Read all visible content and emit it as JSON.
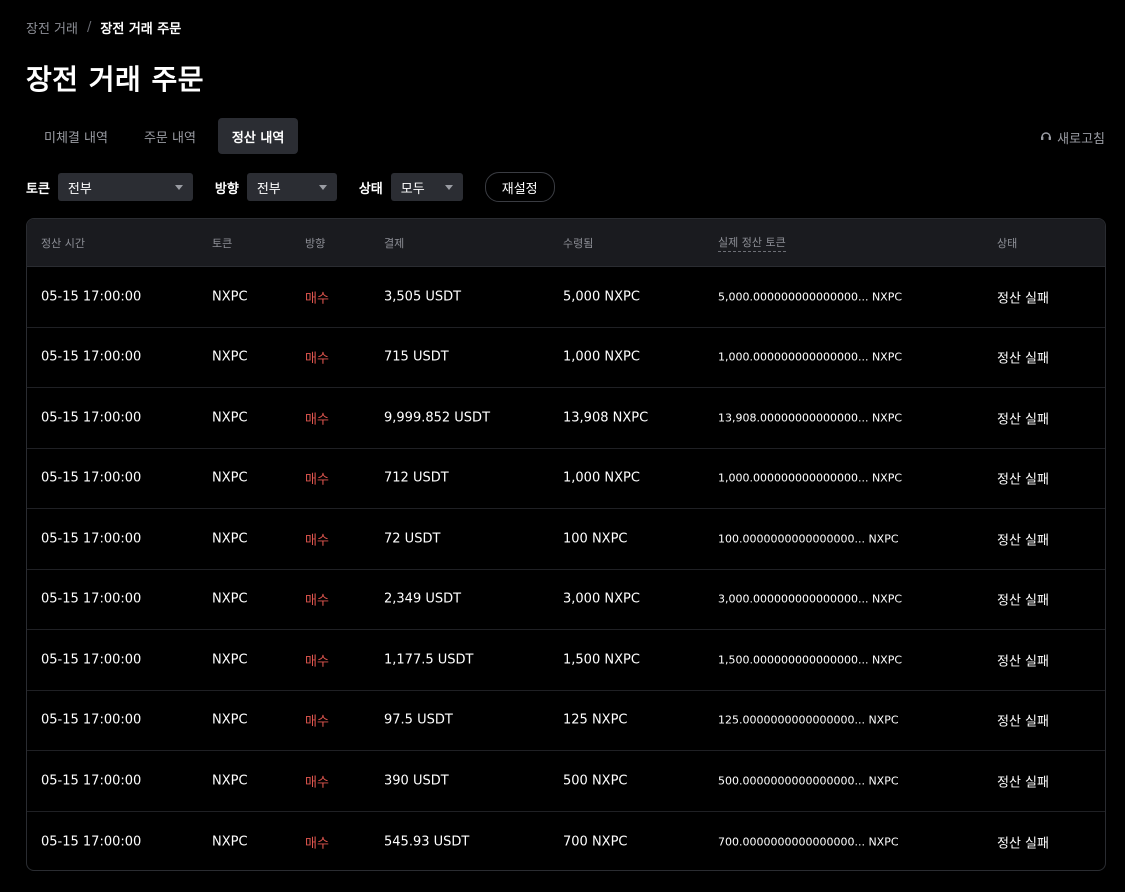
{
  "breadcrumb": {
    "parent": "장전 거래",
    "separator": "/",
    "current": "장전 거래 주문"
  },
  "page_title": "장전 거래 주문",
  "tabs": [
    {
      "label": "미체결 내역",
      "active": false
    },
    {
      "label": "주문 내역",
      "active": false
    },
    {
      "label": "정산 내역",
      "active": true
    }
  ],
  "refresh_label": "새로고침",
  "filters": {
    "token": {
      "label": "토큰",
      "value": "전부"
    },
    "direction": {
      "label": "방향",
      "value": "전부"
    },
    "status": {
      "label": "상태",
      "value": "모두"
    },
    "reset_label": "재설정"
  },
  "table": {
    "headers": [
      "정산 시간",
      "토큰",
      "방향",
      "결제",
      "수령됨",
      "실제 정산 토큰",
      "상태"
    ],
    "rows": [
      {
        "time": "05-15 17:00:00",
        "token": "NXPC",
        "direction": "매수",
        "payment": "3,505 USDT",
        "received": "5,000 NXPC",
        "actual": "5,000.000000000000000... NXPC",
        "status": "정산 실패"
      },
      {
        "time": "05-15 17:00:00",
        "token": "NXPC",
        "direction": "매수",
        "payment": "715 USDT",
        "received": "1,000 NXPC",
        "actual": "1,000.000000000000000... NXPC",
        "status": "정산 실패"
      },
      {
        "time": "05-15 17:00:00",
        "token": "NXPC",
        "direction": "매수",
        "payment": "9,999.852 USDT",
        "received": "13,908 NXPC",
        "actual": "13,908.00000000000000... NXPC",
        "status": "정산 실패"
      },
      {
        "time": "05-15 17:00:00",
        "token": "NXPC",
        "direction": "매수",
        "payment": "712 USDT",
        "received": "1,000 NXPC",
        "actual": "1,000.000000000000000... NXPC",
        "status": "정산 실패"
      },
      {
        "time": "05-15 17:00:00",
        "token": "NXPC",
        "direction": "매수",
        "payment": "72 USDT",
        "received": "100 NXPC",
        "actual": "100.0000000000000000... NXPC",
        "status": "정산 실패"
      },
      {
        "time": "05-15 17:00:00",
        "token": "NXPC",
        "direction": "매수",
        "payment": "2,349 USDT",
        "received": "3,000 NXPC",
        "actual": "3,000.000000000000000... NXPC",
        "status": "정산 실패"
      },
      {
        "time": "05-15 17:00:00",
        "token": "NXPC",
        "direction": "매수",
        "payment": "1,177.5 USDT",
        "received": "1,500 NXPC",
        "actual": "1,500.000000000000000... NXPC",
        "status": "정산 실패"
      },
      {
        "time": "05-15 17:00:00",
        "token": "NXPC",
        "direction": "매수",
        "payment": "97.5 USDT",
        "received": "125 NXPC",
        "actual": "125.0000000000000000... NXPC",
        "status": "정산 실패"
      },
      {
        "time": "05-15 17:00:00",
        "token": "NXPC",
        "direction": "매수",
        "payment": "390 USDT",
        "received": "500 NXPC",
        "actual": "500.0000000000000000... NXPC",
        "status": "정산 실패"
      },
      {
        "time": "05-15 17:00:00",
        "token": "NXPC",
        "direction": "매수",
        "payment": "545.93 USDT",
        "received": "700 NXPC",
        "actual": "700.0000000000000000... NXPC",
        "status": "정산 실패"
      }
    ]
  },
  "colors": {
    "background": "#000000",
    "buy": "#e0564f",
    "panel": "#2b2d33",
    "header_bg": "#1a1b1f"
  }
}
